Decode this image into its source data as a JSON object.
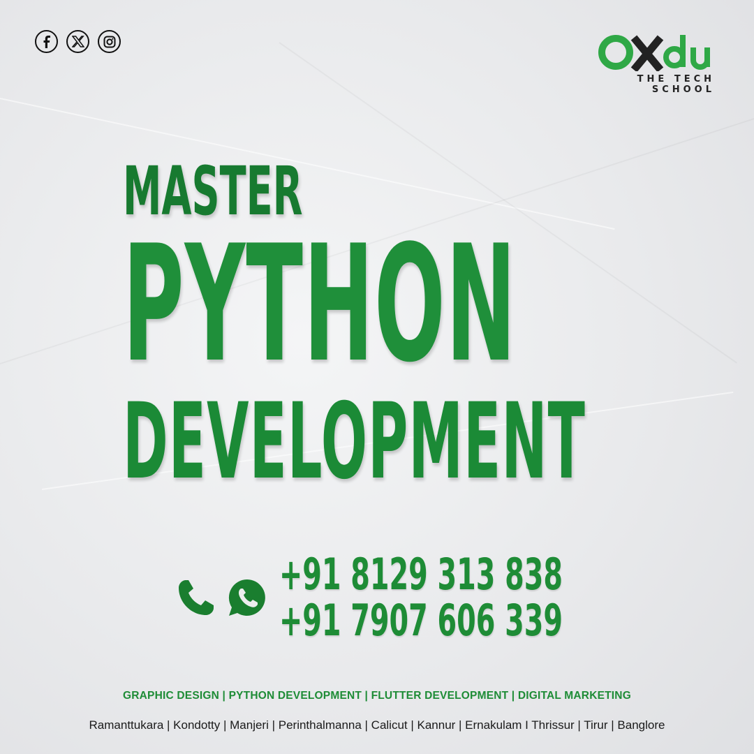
{
  "social": {
    "icons": [
      "facebook-icon",
      "x-twitter-icon",
      "instagram-icon"
    ]
  },
  "logo": {
    "word_o": "O",
    "word_x": "X",
    "word_du": "du",
    "tagline": "THE TECH SCHOOL"
  },
  "headline": {
    "line1": "MASTER",
    "line2": "PYTHON",
    "line3": "DEVELOPMENT"
  },
  "contact": {
    "icons": [
      "phone-icon",
      "whatsapp-icon"
    ],
    "phone1": "+91 8129 313 838",
    "phone2": "+91 7907 606 339"
  },
  "footer": {
    "courses": "GRAPHIC DESIGN | PYTHON DEVELOPMENT | FLUTTER DEVELOPMENT | DIGITAL MARKETING",
    "locations": "Ramanttukara | Kondotty | Manjeri | Perinthalmanna | Calicut | Kannur | Ernakulam I Thrissur | Tirur | Banglore"
  },
  "colors": {
    "brand_green": "#1e8c36",
    "dark_green": "#177a30",
    "logo_green": "#2fa846",
    "background": "#eceded",
    "text_dark": "#1a1a1a"
  }
}
